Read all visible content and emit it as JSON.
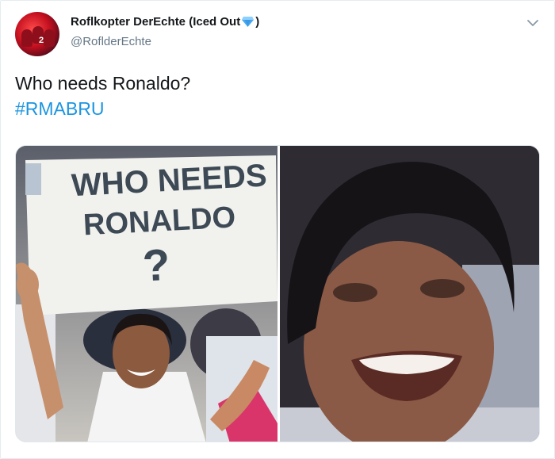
{
  "author": {
    "display_name": "Roflkopter DerEchte (Iced Out",
    "name_suffix": ")",
    "handle": "@RoflderEchte",
    "avatar_badge": "2"
  },
  "tweet": {
    "text": "Who needs Ronaldo?",
    "hashtag": "#RMABRU"
  },
  "media": {
    "left_image": {
      "sign_line_1": "WHO NEEDS",
      "sign_line_2": "RONALDO",
      "sign_line_3": "?"
    }
  },
  "colors": {
    "link": "#1b95e0",
    "text": "#14171a",
    "secondary": "#657786",
    "diamond": "#4aa8f0"
  },
  "icons": {
    "menu": "chevron-down-icon",
    "verified_style": "diamond-icon"
  }
}
